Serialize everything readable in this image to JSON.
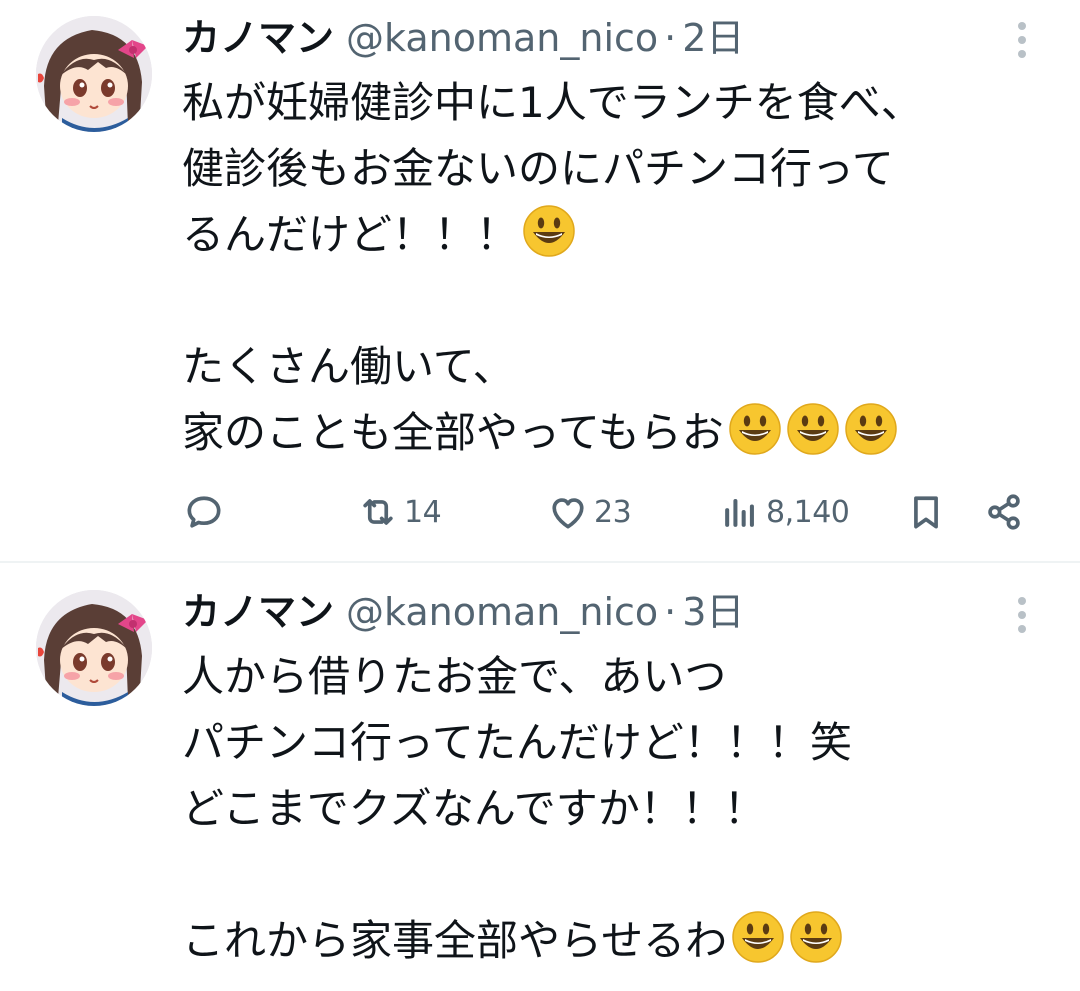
{
  "tweets": [
    {
      "display_name": "カノマン",
      "handle": "@kanoman_nico",
      "separator": "·",
      "time": "2日",
      "lines": [
        {
          "text": "私が妊婦健診中に1人でランチを食べ、",
          "emojis": 0
        },
        {
          "text": "健診後もお金ないのにパチンコ行って",
          "emojis": 0
        },
        {
          "text": "るんだけど！！！",
          "emojis": 1
        },
        {
          "text": "",
          "emojis": 0
        },
        {
          "text": "たくさん働いて、",
          "emojis": 0
        },
        {
          "text": "家のことも全部やってもらお",
          "emojis": 3
        }
      ],
      "emoji_icon": "grinning-face-emoji",
      "actions": {
        "reply": {
          "icon": "reply-icon",
          "count": ""
        },
        "retweet": {
          "icon": "retweet-icon",
          "count": "14"
        },
        "like": {
          "icon": "heart-icon",
          "count": "23"
        },
        "views": {
          "icon": "views-icon",
          "count": "8,140"
        },
        "bookmark": {
          "icon": "bookmark-icon"
        },
        "share": {
          "icon": "share-icon"
        }
      }
    },
    {
      "display_name": "カノマン",
      "handle": "@kanoman_nico",
      "separator": "·",
      "time": "3日",
      "lines": [
        {
          "text": "人から借りたお金で、あいつ",
          "emojis": 0
        },
        {
          "text": "パチンコ行ってたんだけど！！！笑",
          "emojis": 0
        },
        {
          "text": "どこまでクズなんですか！！！",
          "emojis": 0
        },
        {
          "text": "",
          "emojis": 0
        },
        {
          "text": "これから家事全部やらせるわ",
          "emojis": 2
        }
      ],
      "emoji_icon": "grinning-face-emoji"
    }
  ],
  "colors": {
    "text_primary": "#0f1419",
    "text_secondary": "#536471",
    "divider": "#eff3f4",
    "emoji_yellow": "#f7c62f"
  }
}
